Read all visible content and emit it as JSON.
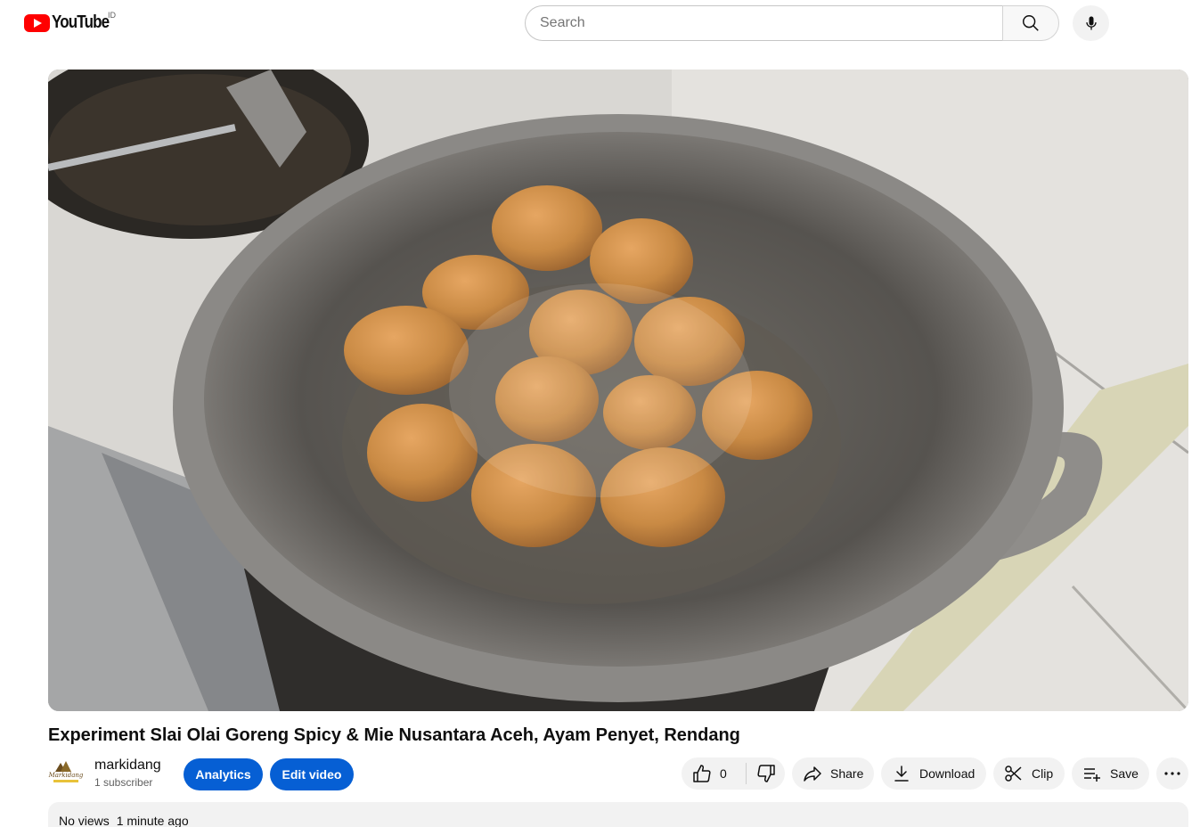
{
  "header": {
    "logo_text": "YouTube",
    "country_code": "ID",
    "search_placeholder": "Search"
  },
  "video": {
    "title": "Experiment Slai Olai Goreng Spicy & Mie Nusantara Aceh, Ayam Penyet, Rendang"
  },
  "channel": {
    "name": "markidang",
    "subscribers": "1 subscriber",
    "avatar_text": "Markidang"
  },
  "owner_buttons": {
    "analytics": "Analytics",
    "edit_video": "Edit video"
  },
  "actions": {
    "like_count": "0",
    "share": "Share",
    "download": "Download",
    "clip": "Clip",
    "save": "Save"
  },
  "description": {
    "views": "No views",
    "time": "1 minute ago"
  },
  "colors": {
    "brand_red": "#ff0000",
    "primary_blue": "#065fd4",
    "pill_gray": "#f2f2f2"
  }
}
